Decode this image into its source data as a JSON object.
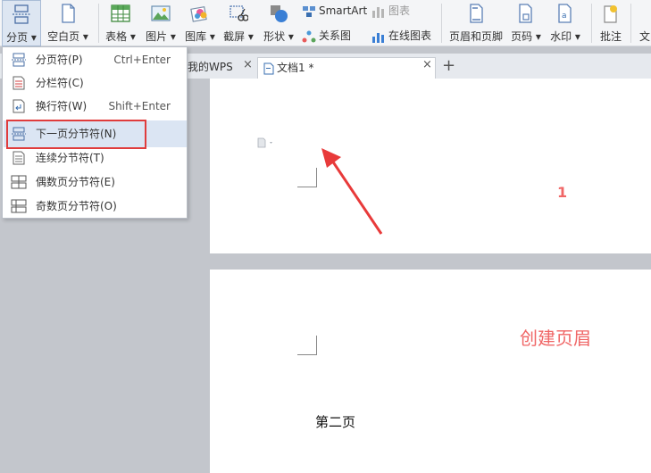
{
  "ribbon": {
    "buttons": [
      {
        "label": "分页 ▾",
        "icon": "page-break-icon"
      },
      {
        "label": "空白页 ▾",
        "icon": "blank-page-icon"
      },
      {
        "label": "表格 ▾",
        "icon": "table-icon"
      },
      {
        "label": "图片 ▾",
        "icon": "picture-icon"
      },
      {
        "label": "图库 ▾",
        "icon": "gallery-icon"
      },
      {
        "label": "截屏 ▾",
        "icon": "screenshot-icon"
      },
      {
        "label": "形状 ▾",
        "icon": "shapes-icon"
      },
      {
        "label": "页眉和页脚",
        "icon": "header-footer-icon"
      },
      {
        "label": "页码 ▾",
        "icon": "page-number-icon"
      },
      {
        "label": "水印 ▾",
        "icon": "watermark-icon"
      },
      {
        "label": "批注",
        "icon": "comment-icon"
      },
      {
        "label": "文",
        "icon": "text-icon"
      }
    ],
    "smartart": "SmartArt",
    "chart": "图表",
    "relation": "关系图",
    "online_chart": "在线图表"
  },
  "tabs": {
    "my_wps": "我的WPS",
    "doc": "文档1 *",
    "close": "×",
    "add": "+"
  },
  "menu": {
    "items": [
      {
        "label": "分页符(P)",
        "shortcut": "Ctrl+Enter",
        "icon": "page-break-item-icon"
      },
      {
        "label": "分栏符(C)",
        "shortcut": "",
        "icon": "column-break-icon"
      },
      {
        "label": "换行符(W)",
        "shortcut": "Shift+Enter",
        "icon": "line-break-icon"
      },
      {
        "label": "下一页分节符(N)",
        "shortcut": "",
        "icon": "next-page-section-icon"
      },
      {
        "label": "连续分节符(T)",
        "shortcut": "",
        "icon": "continuous-section-icon"
      },
      {
        "label": "偶数页分节符(E)",
        "shortcut": "",
        "icon": "even-page-section-icon"
      },
      {
        "label": "奇数页分节符(O)",
        "shortcut": "",
        "icon": "odd-page-section-icon"
      }
    ]
  },
  "document": {
    "marker_1": "1",
    "annotation": "创建页眉",
    "page2_text": "第二页"
  },
  "colors": {
    "annotation_red": "#f06666",
    "highlight_box": "#e03c3c",
    "arrow": "#e83a3a",
    "menu_hover": "#dbe5f3"
  }
}
